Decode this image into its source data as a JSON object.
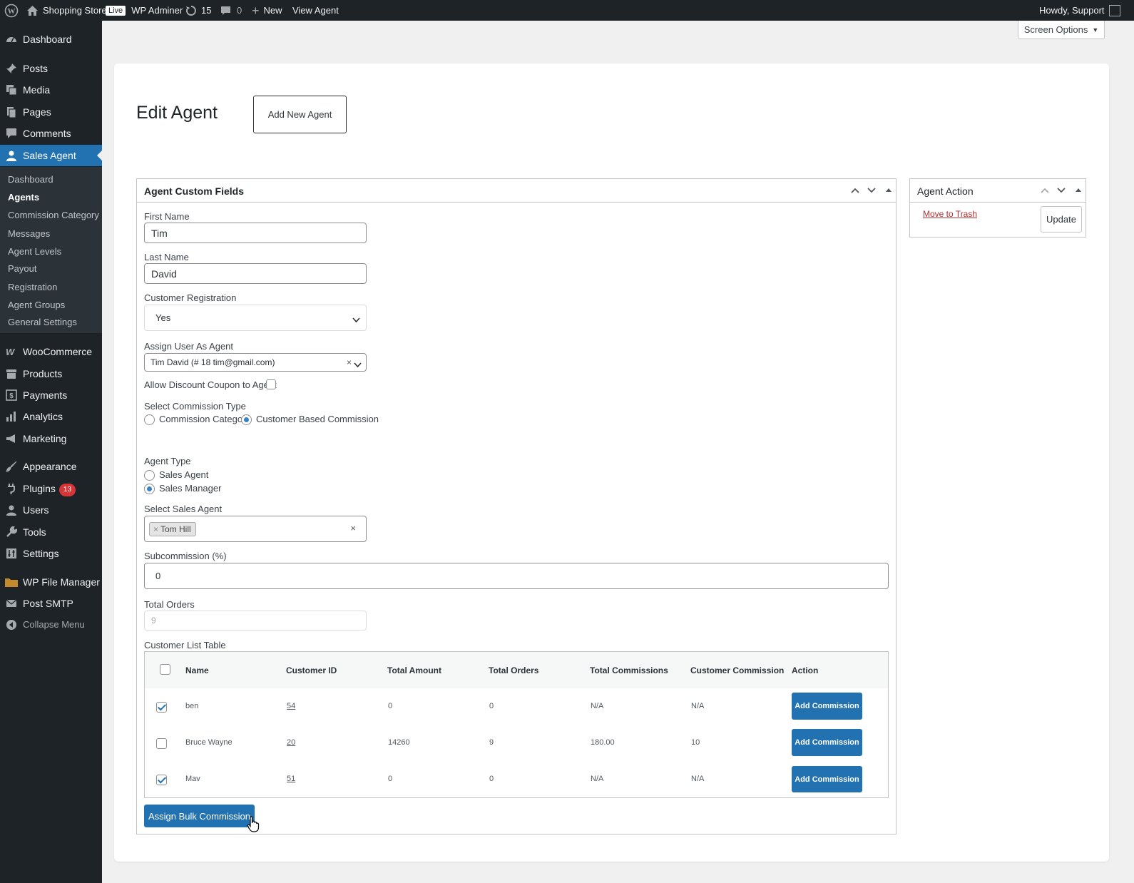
{
  "admin_bar": {
    "site_name": "Shopping Store",
    "live_badge": "Live",
    "wp_adminer": "WP Adminer",
    "updates_count": "15",
    "comments_count": "0",
    "new_label": "New",
    "view_agent": "View Agent",
    "howdy": "Howdy, Support"
  },
  "sidebar": {
    "dashboard": "Dashboard",
    "posts": "Posts",
    "media": "Media",
    "pages": "Pages",
    "comments": "Comments",
    "sales_agent": "Sales Agent",
    "submenu": [
      "Dashboard",
      "Agents",
      "Commission Category",
      "Messages",
      "Agent Levels",
      "Payout",
      "Registration",
      "Agent Groups",
      "General Settings"
    ],
    "woocommerce": "WooCommerce",
    "products": "Products",
    "payments": "Payments",
    "analytics": "Analytics",
    "marketing": "Marketing",
    "appearance": "Appearance",
    "plugins": "Plugins",
    "plugins_badge": "13",
    "users": "Users",
    "tools": "Tools",
    "settings": "Settings",
    "wp_file_manager": "WP File Manager",
    "post_smtp": "Post SMTP",
    "collapse": "Collapse Menu"
  },
  "screen_options": "Screen Options",
  "page": {
    "title": "Edit Agent",
    "add_new_button": "Add New Agent"
  },
  "agent_fields": {
    "box_title": "Agent Custom Fields",
    "first_name_label": "First Name",
    "first_name_value": "Tim",
    "last_name_label": "Last Name",
    "last_name_value": "David",
    "customer_registration_label": "Customer Registration",
    "customer_registration_value": "Yes",
    "assign_user_label": "Assign User As Agent",
    "assign_user_value": "Tim David (# 18 tim@gmail.com)",
    "allow_discount_label": "Allow Discount Coupon to Agent",
    "commission_type_label": "Select Commission Type",
    "commission_type_options": [
      "Commission Category",
      "Customer Based Commission"
    ],
    "commission_type_selected": "Customer Based Commission",
    "agent_type_label": "Agent Type",
    "agent_type_options": [
      "Sales Agent",
      "Sales Manager"
    ],
    "agent_type_selected": "Sales Manager",
    "select_sales_agent_label": "Select Sales Agent",
    "selected_sales_agent": "Tom Hill",
    "subcommission_label": "Subcommission (%)",
    "subcommission_value": "0",
    "total_orders_label": "Total Orders",
    "total_orders_value": "9",
    "customer_list_label": "Customer List Table"
  },
  "customer_table": {
    "headers": [
      "Name",
      "Customer ID",
      "Total Amount",
      "Total Orders",
      "Total Commissions",
      "Customer Commission",
      "Action"
    ],
    "rows": [
      {
        "checked": true,
        "name": "ben",
        "customer_id": "54",
        "total_amount": "0",
        "total_orders": "0",
        "total_commissions": "N/A",
        "customer_commission": "N/A",
        "action": "Add Commission"
      },
      {
        "checked": false,
        "name": "Bruce Wayne",
        "customer_id": "20",
        "total_amount": "14260",
        "total_orders": "9",
        "total_commissions": "180.00",
        "customer_commission": "10",
        "action": "Add Commission"
      },
      {
        "checked": true,
        "name": "Mav",
        "customer_id": "51",
        "total_amount": "0",
        "total_orders": "0",
        "total_commissions": "N/A",
        "customer_commission": "N/A",
        "action": "Add Commission"
      }
    ],
    "bulk_button": "Assign Bulk Commission"
  },
  "agent_action": {
    "box_title": "Agent Action",
    "trash_link": "Move to Trash",
    "update_button": "Update"
  },
  "colors": {
    "admin_bar": "#1d2327",
    "primary": "#2271b1",
    "trash": "#b32d2e",
    "badge": "#d63638"
  }
}
